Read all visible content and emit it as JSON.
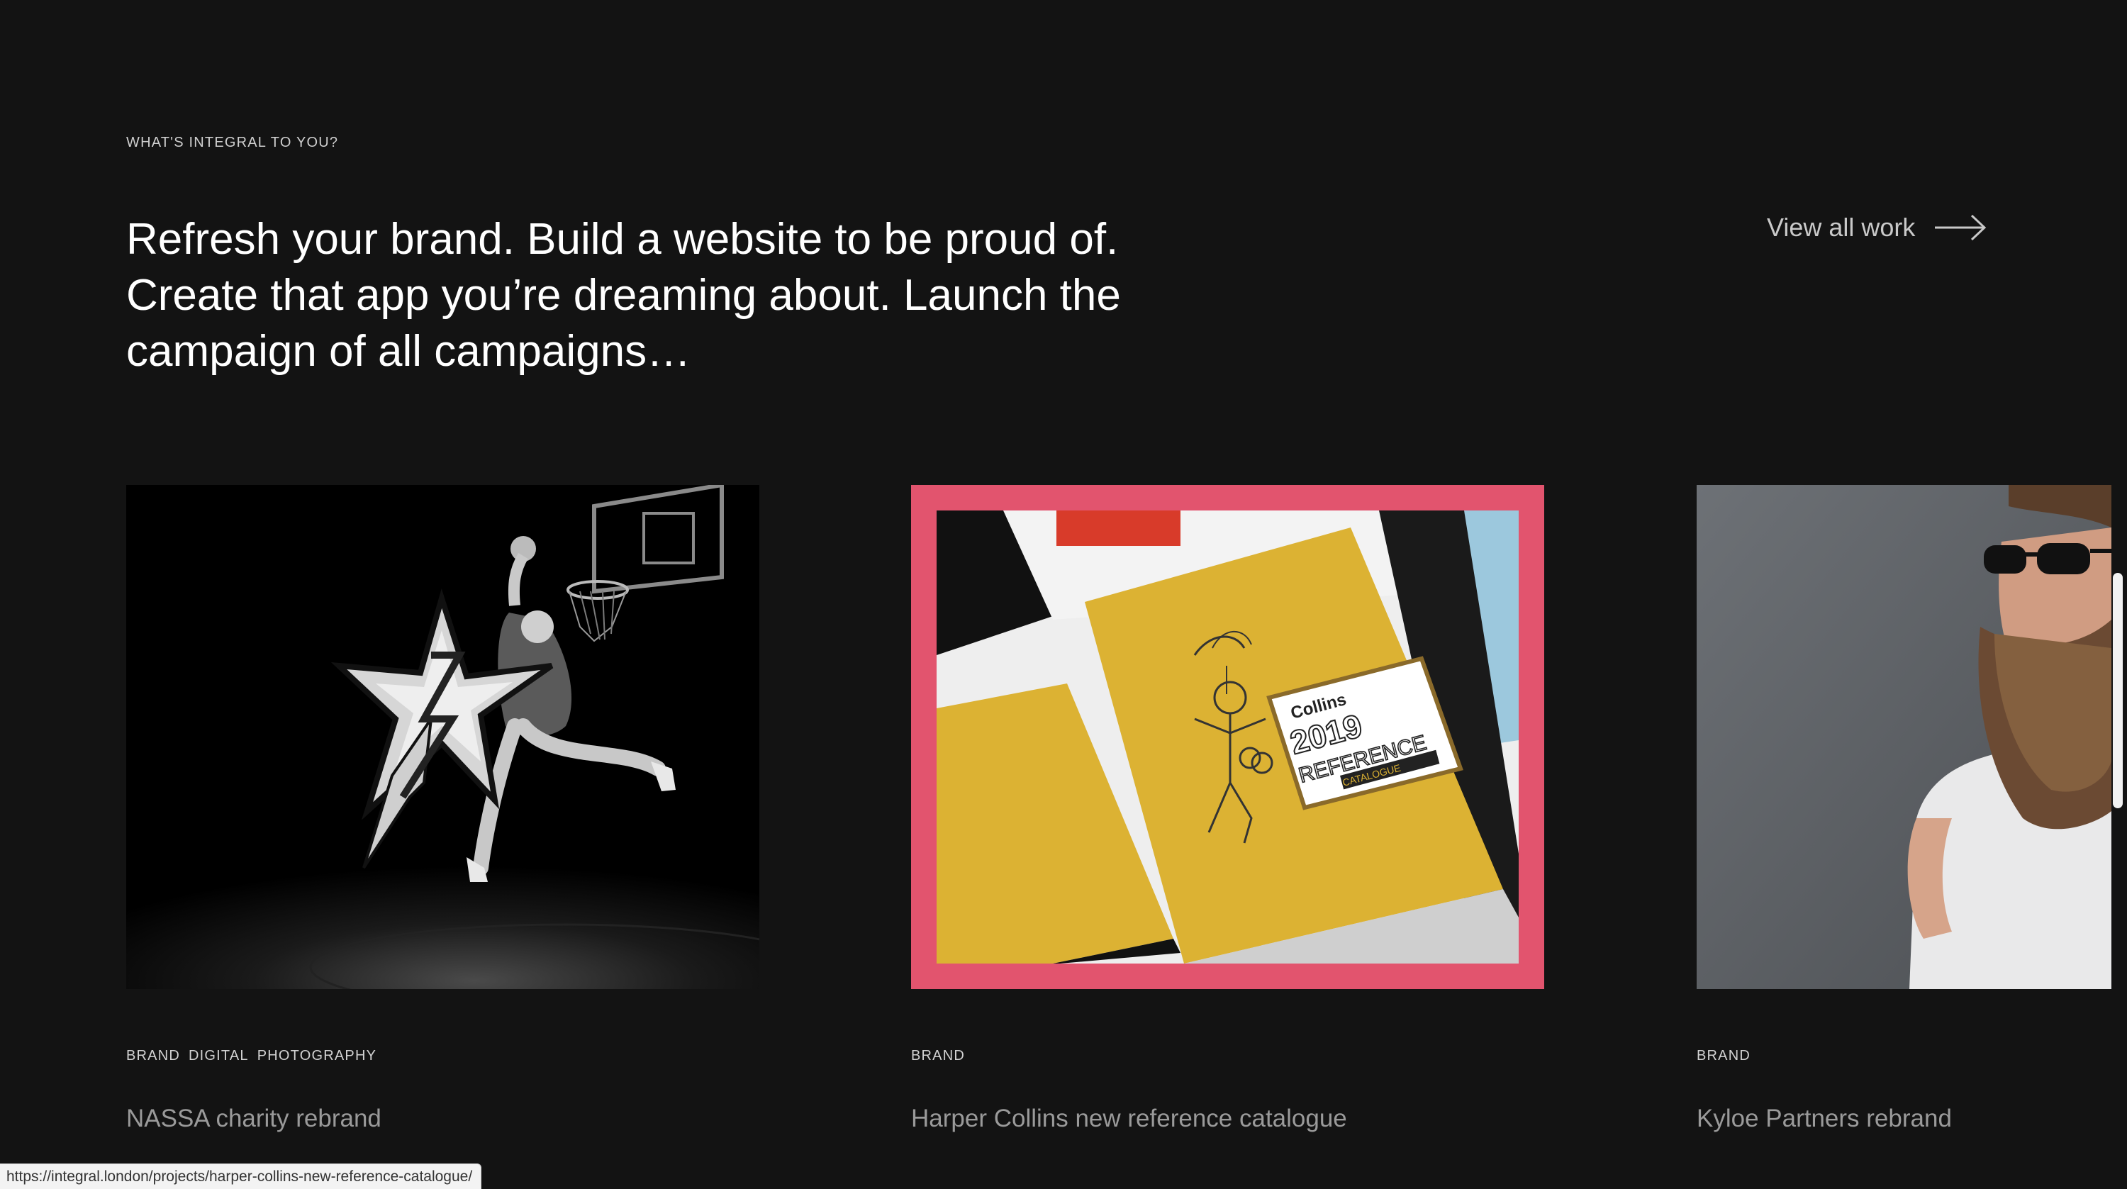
{
  "section": {
    "eyebrow": "WHAT'S INTEGRAL TO YOU?",
    "headline": "Refresh your brand. Build a website to be proud of. Create that app you’re dreaming about. Launch the campaign of all campaigns…",
    "view_all_label": "View all work"
  },
  "projects": [
    {
      "tags": [
        "BRAND",
        "DIGITAL",
        "PHOTOGRAPHY"
      ],
      "title": "NASSA charity rebrand"
    },
    {
      "tags": [
        "BRAND"
      ],
      "title": "Harper Collins new reference catalogue",
      "cover_text": {
        "publisher": "Collins",
        "year": "2019",
        "title": "REFERENCE",
        "subtitle": "CATALOGUE"
      }
    },
    {
      "tags": [
        "BRAND"
      ],
      "title": "Kyloe Partners rebrand"
    }
  ],
  "status_bar": {
    "url": "https://integral.london/projects/harper-collins-new-reference-catalogue/"
  },
  "colors": {
    "background": "#131313",
    "accent_pink": "#e2546e",
    "book_yellow": "#dcb233"
  }
}
